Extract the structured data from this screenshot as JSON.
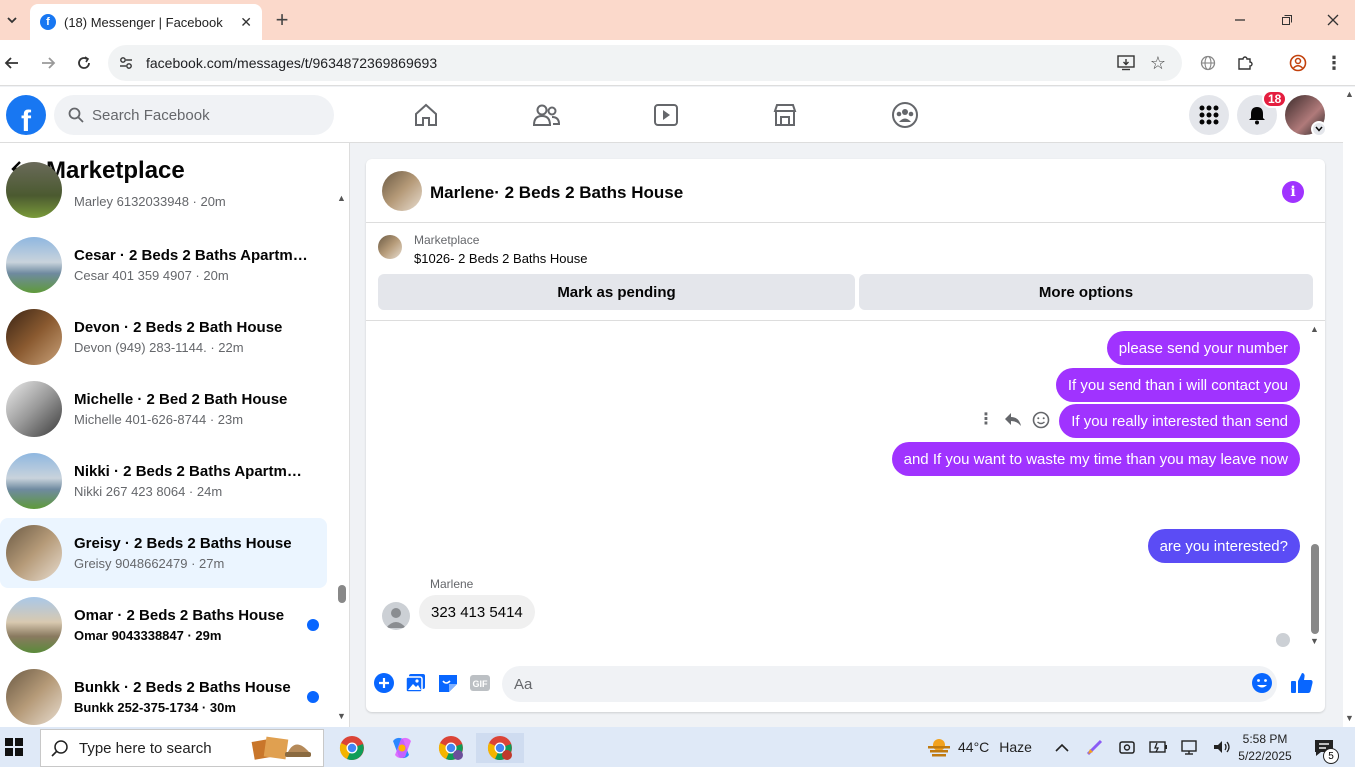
{
  "browser": {
    "tab_title": "(18) Messenger | Facebook",
    "url": "facebook.com/messages/t/9634872369869693",
    "new_tab_label": "+"
  },
  "facebook": {
    "search_placeholder": "Search Facebook",
    "notification_count": "18"
  },
  "sidebar": {
    "title": "Marketplace",
    "conversations": [
      {
        "name": "",
        "subtitle": "Marley 6132033948 · 20m",
        "unread": false,
        "selected": false
      },
      {
        "name": "Cesar · 2 Beds 2 Baths Apartmen...",
        "subtitle": "Cesar 401 359 4907 · 20m",
        "unread": false,
        "selected": false
      },
      {
        "name": "Devon · 2 Beds 2 Bath House",
        "subtitle": "Devon (949) 283-1144. · 22m",
        "unread": false,
        "selected": false
      },
      {
        "name": "Michelle · 2 Bed 2 Bath House",
        "subtitle": "Michelle 401-626-8744 · 23m",
        "unread": false,
        "selected": false
      },
      {
        "name": "Nikki · 2 Beds 2 Baths Apartmen...",
        "subtitle": "Nikki 267 423 8064 · 24m",
        "unread": false,
        "selected": false
      },
      {
        "name": "Greisy · 2 Beds 2 Baths House",
        "subtitle": "Greisy 9048662479 · 27m",
        "unread": false,
        "selected": true
      },
      {
        "name": "Omar · 2 Beds 2 Baths House",
        "subtitle": "Omar 9043338847 · 29m",
        "unread": true,
        "selected": false
      },
      {
        "name": "Bunkk · 2 Beds 2 Baths House",
        "subtitle": "Bunkk 252-375-1734 · 30m",
        "unread": true,
        "selected": false
      }
    ]
  },
  "chat": {
    "title": "Marlene· 2 Beds 2 Baths House",
    "listing_label": "Marketplace",
    "listing_title": "$1026- 2 Beds 2 Baths House",
    "mark_pending_label": "Mark as pending",
    "more_options_label": "More options",
    "messages_out": [
      "please send your number",
      "If you send than i will contact you",
      "If you really interested than send",
      "and If you want to waste my time than you may leave now",
      "are you  interested?"
    ],
    "incoming_sender": "Marlene",
    "incoming_message": "323 413 5414",
    "composer_placeholder": "Aa",
    "colors": {
      "accent": "#a033ff",
      "accent_blue": "#5b4cf5",
      "fb_blue": "#1877f2"
    }
  },
  "taskbar": {
    "search_placeholder": "Type here to search",
    "temperature": "44°C",
    "weather": "Haze",
    "time": "5:58 PM",
    "date": "5/22/2025",
    "notification_count": "5"
  }
}
